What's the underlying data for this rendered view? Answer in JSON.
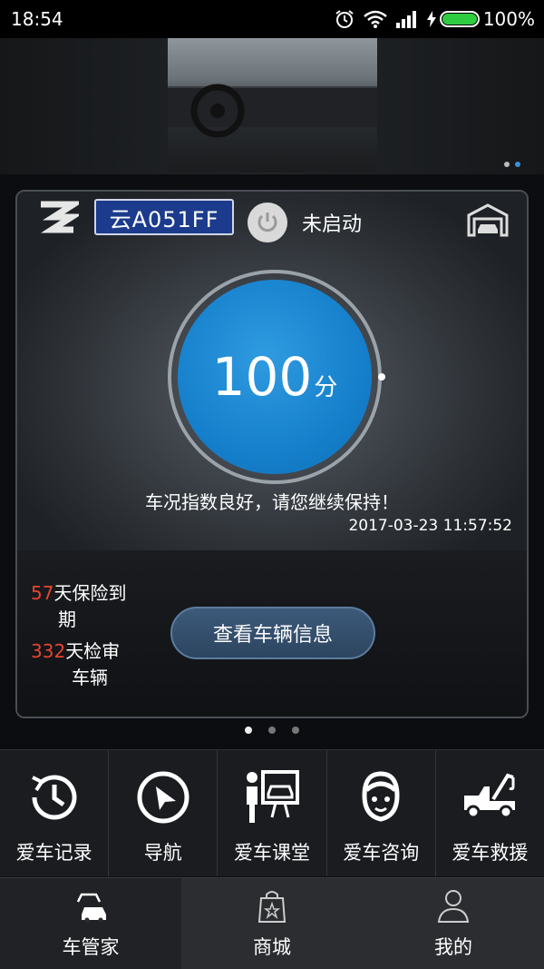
{
  "status": {
    "time": "18:54",
    "battery": "100%",
    "battery_level": 1.0
  },
  "banner": {
    "page_count": 2,
    "active_page": 1
  },
  "card": {
    "plate": "云A051FF",
    "engine_status": "未启动",
    "score": "100",
    "score_unit": "分",
    "condition_message": "车况指数良好，请您继续保持！",
    "timestamp": "2017-03-23 11:57:52",
    "insurance": {
      "days": "57",
      "text_line1": "天保险到",
      "text_line2": "期"
    },
    "inspection": {
      "days": "332",
      "text_line1": "天检审",
      "text_line2": "车辆"
    },
    "view_button": "查看车辆信息"
  },
  "pager": {
    "count": 3,
    "active": 0
  },
  "actions": [
    {
      "label": "爱车记录",
      "icon": "clock-icon"
    },
    {
      "label": "导航",
      "icon": "navigation-icon"
    },
    {
      "label": "爱车课堂",
      "icon": "classroom-icon"
    },
    {
      "label": "爱车咨询",
      "icon": "support-agent-icon"
    },
    {
      "label": "爱车救援",
      "icon": "tow-truck-icon"
    }
  ],
  "bottom_nav": [
    {
      "label": "车管家",
      "icon": "car-icon",
      "active": true
    },
    {
      "label": "商城",
      "icon": "shopping-bag-icon",
      "active": false
    },
    {
      "label": "我的",
      "icon": "user-icon",
      "active": false
    }
  ],
  "colors": {
    "accent_blue": "#1680cc",
    "warning_red": "#e8442e",
    "battery_green": "#2ecc40"
  }
}
